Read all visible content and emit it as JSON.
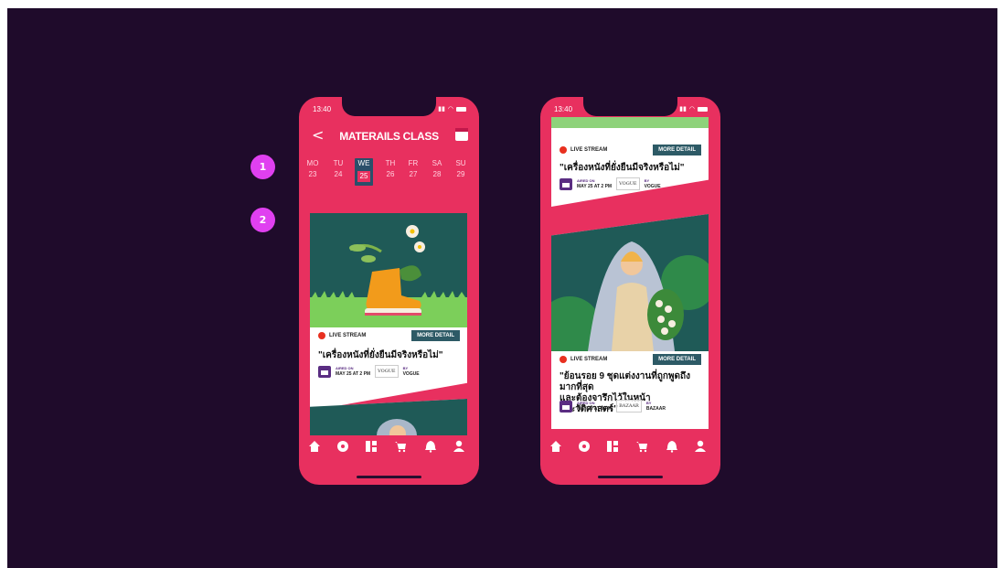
{
  "markers": [
    "1",
    "2"
  ],
  "left": {
    "time": "13:40",
    "title": "MATERAILS CLASS",
    "back": "<",
    "days": [
      {
        "name": "MO",
        "num": "23"
      },
      {
        "name": "TU",
        "num": "24"
      },
      {
        "name": "WE",
        "num": "25",
        "selected": true
      },
      {
        "name": "TH",
        "num": "26"
      },
      {
        "name": "FR",
        "num": "27"
      },
      {
        "name": "SA",
        "num": "28"
      },
      {
        "name": "SU",
        "num": "29"
      }
    ],
    "card": {
      "live": "LIVE STREAM",
      "more": "MORE DETAIL",
      "title": "\"เครื่องหนังที่ยั่งยืนมีจริงหรือไม่\"",
      "airedon": "AIRED ON",
      "date": "MAY 25 AT 2 PM",
      "brand": "VOGUE",
      "by": "BY",
      "source": "VOGUE"
    }
  },
  "right": {
    "time": "13:40",
    "card1": {
      "live": "LIVE STREAM",
      "more": "MORE DETAIL",
      "title": "\"เครื่องหนังที่ยั่งยืนมีจริงหรือไม่\"",
      "airedon": "AIRED ON",
      "date": "MAY 25 AT 2 PM",
      "brand": "VOGUE",
      "by": "BY",
      "source": "VOGUE"
    },
    "card2": {
      "live": "LIVE STREAM",
      "more": "MORE DETAIL",
      "title1": "\"ย้อนรอย 9 ชุดแต่งงานที่ถูกพูดถึงมากที่สุด",
      "title2": "และต้องจารึกไว้ในหน้าประวัติศาสตร์\"",
      "airedon": "AIRED ON",
      "date": "MAY 25 AT 8 PM",
      "brand": "BAZAAR",
      "by": "BY",
      "source": "BAZAAR"
    }
  },
  "nav_icons": [
    "home-icon",
    "compass-icon",
    "grid-icon",
    "cart-icon",
    "bell-icon",
    "profile-icon"
  ],
  "colors": {
    "background": "#1f0b2b",
    "phone": "#e8305f",
    "accent": "#2d5a66",
    "live": "#e8301f"
  }
}
